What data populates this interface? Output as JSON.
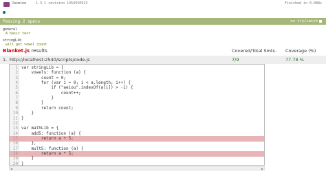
{
  "jasmine": {
    "title": "Jasmine",
    "version": "1.3.1 revision 1354556913",
    "finished": "Finished in 0.088s"
  },
  "summary": {
    "passing_text": "Passing 2 specs",
    "try_catch_label": "no try/catch"
  },
  "specs": [
    {
      "suite": "general",
      "spec": "A basic test"
    },
    {
      "suite": "stringLib",
      "spec": "will get vowel count"
    }
  ],
  "blanket": {
    "brand": "Blanket.js",
    "results_label": " results",
    "covered_header": "Covered/Total Smts.",
    "coverage_header": "Coverage (%)"
  },
  "file": {
    "number": "1.",
    "path": "http://localhost:2540/scripts/code.js",
    "covered": "7/9",
    "coverage": "77.78 %"
  },
  "code_lines": [
    {
      "n": "1",
      "text": "var stringLib = {",
      "miss": false
    },
    {
      "n": "2",
      "text": "    vowels: function (a) {",
      "miss": false
    },
    {
      "n": "3",
      "text": "        count = 0;",
      "miss": false
    },
    {
      "n": "4",
      "text": "        for (var i = 0; i < a.length; i++) {",
      "miss": false
    },
    {
      "n": "5",
      "text": "            if (\"aeiou\".indexOf(a[i]) > -1) {",
      "miss": false
    },
    {
      "n": "6",
      "text": "                count++;",
      "miss": false
    },
    {
      "n": "7",
      "text": "            }",
      "miss": false
    },
    {
      "n": "8",
      "text": "        }",
      "miss": false
    },
    {
      "n": "9",
      "text": "        return count;",
      "miss": false
    },
    {
      "n": "10",
      "text": "    }",
      "miss": false
    },
    {
      "n": "11",
      "text": "}",
      "miss": false
    },
    {
      "n": "12",
      "text": "",
      "miss": false
    },
    {
      "n": "13",
      "text": "var mathLib = {",
      "miss": false
    },
    {
      "n": "14",
      "text": "    add5: function (a) {",
      "miss": false
    },
    {
      "n": "15",
      "text": "        return a + 5;",
      "miss": true
    },
    {
      "n": "16",
      "text": "    },",
      "miss": false
    },
    {
      "n": "17",
      "text": "    mult5: function (a) {",
      "miss": false
    },
    {
      "n": "18",
      "text": "        return a * 5;",
      "miss": true
    },
    {
      "n": "19",
      "text": "    }",
      "miss": false
    },
    {
      "n": "20",
      "text": "}",
      "miss": false
    }
  ],
  "colors": {
    "passing_bar": "#a6b779",
    "miss_line": "#e8b4b8",
    "brand": "#cc0000"
  }
}
